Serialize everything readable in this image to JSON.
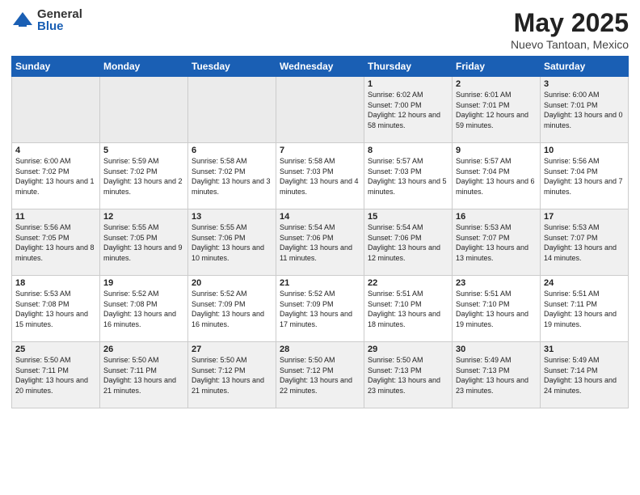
{
  "logo": {
    "general": "General",
    "blue": "Blue"
  },
  "title": "May 2025",
  "subtitle": "Nuevo Tantoan, Mexico",
  "weekdays": [
    "Sunday",
    "Monday",
    "Tuesday",
    "Wednesday",
    "Thursday",
    "Friday",
    "Saturday"
  ],
  "weeks": [
    [
      {
        "day": "",
        "sunrise": "",
        "sunset": "",
        "daylight": ""
      },
      {
        "day": "",
        "sunrise": "",
        "sunset": "",
        "daylight": ""
      },
      {
        "day": "",
        "sunrise": "",
        "sunset": "",
        "daylight": ""
      },
      {
        "day": "",
        "sunrise": "",
        "sunset": "",
        "daylight": ""
      },
      {
        "day": "1",
        "sunrise": "Sunrise: 6:02 AM",
        "sunset": "Sunset: 7:00 PM",
        "daylight": "Daylight: 12 hours and 58 minutes."
      },
      {
        "day": "2",
        "sunrise": "Sunrise: 6:01 AM",
        "sunset": "Sunset: 7:01 PM",
        "daylight": "Daylight: 12 hours and 59 minutes."
      },
      {
        "day": "3",
        "sunrise": "Sunrise: 6:00 AM",
        "sunset": "Sunset: 7:01 PM",
        "daylight": "Daylight: 13 hours and 0 minutes."
      }
    ],
    [
      {
        "day": "4",
        "sunrise": "Sunrise: 6:00 AM",
        "sunset": "Sunset: 7:02 PM",
        "daylight": "Daylight: 13 hours and 1 minute."
      },
      {
        "day": "5",
        "sunrise": "Sunrise: 5:59 AM",
        "sunset": "Sunset: 7:02 PM",
        "daylight": "Daylight: 13 hours and 2 minutes."
      },
      {
        "day": "6",
        "sunrise": "Sunrise: 5:58 AM",
        "sunset": "Sunset: 7:02 PM",
        "daylight": "Daylight: 13 hours and 3 minutes."
      },
      {
        "day": "7",
        "sunrise": "Sunrise: 5:58 AM",
        "sunset": "Sunset: 7:03 PM",
        "daylight": "Daylight: 13 hours and 4 minutes."
      },
      {
        "day": "8",
        "sunrise": "Sunrise: 5:57 AM",
        "sunset": "Sunset: 7:03 PM",
        "daylight": "Daylight: 13 hours and 5 minutes."
      },
      {
        "day": "9",
        "sunrise": "Sunrise: 5:57 AM",
        "sunset": "Sunset: 7:04 PM",
        "daylight": "Daylight: 13 hours and 6 minutes."
      },
      {
        "day": "10",
        "sunrise": "Sunrise: 5:56 AM",
        "sunset": "Sunset: 7:04 PM",
        "daylight": "Daylight: 13 hours and 7 minutes."
      }
    ],
    [
      {
        "day": "11",
        "sunrise": "Sunrise: 5:56 AM",
        "sunset": "Sunset: 7:05 PM",
        "daylight": "Daylight: 13 hours and 8 minutes."
      },
      {
        "day": "12",
        "sunrise": "Sunrise: 5:55 AM",
        "sunset": "Sunset: 7:05 PM",
        "daylight": "Daylight: 13 hours and 9 minutes."
      },
      {
        "day": "13",
        "sunrise": "Sunrise: 5:55 AM",
        "sunset": "Sunset: 7:06 PM",
        "daylight": "Daylight: 13 hours and 10 minutes."
      },
      {
        "day": "14",
        "sunrise": "Sunrise: 5:54 AM",
        "sunset": "Sunset: 7:06 PM",
        "daylight": "Daylight: 13 hours and 11 minutes."
      },
      {
        "day": "15",
        "sunrise": "Sunrise: 5:54 AM",
        "sunset": "Sunset: 7:06 PM",
        "daylight": "Daylight: 13 hours and 12 minutes."
      },
      {
        "day": "16",
        "sunrise": "Sunrise: 5:53 AM",
        "sunset": "Sunset: 7:07 PM",
        "daylight": "Daylight: 13 hours and 13 minutes."
      },
      {
        "day": "17",
        "sunrise": "Sunrise: 5:53 AM",
        "sunset": "Sunset: 7:07 PM",
        "daylight": "Daylight: 13 hours and 14 minutes."
      }
    ],
    [
      {
        "day": "18",
        "sunrise": "Sunrise: 5:53 AM",
        "sunset": "Sunset: 7:08 PM",
        "daylight": "Daylight: 13 hours and 15 minutes."
      },
      {
        "day": "19",
        "sunrise": "Sunrise: 5:52 AM",
        "sunset": "Sunset: 7:08 PM",
        "daylight": "Daylight: 13 hours and 16 minutes."
      },
      {
        "day": "20",
        "sunrise": "Sunrise: 5:52 AM",
        "sunset": "Sunset: 7:09 PM",
        "daylight": "Daylight: 13 hours and 16 minutes."
      },
      {
        "day": "21",
        "sunrise": "Sunrise: 5:52 AM",
        "sunset": "Sunset: 7:09 PM",
        "daylight": "Daylight: 13 hours and 17 minutes."
      },
      {
        "day": "22",
        "sunrise": "Sunrise: 5:51 AM",
        "sunset": "Sunset: 7:10 PM",
        "daylight": "Daylight: 13 hours and 18 minutes."
      },
      {
        "day": "23",
        "sunrise": "Sunrise: 5:51 AM",
        "sunset": "Sunset: 7:10 PM",
        "daylight": "Daylight: 13 hours and 19 minutes."
      },
      {
        "day": "24",
        "sunrise": "Sunrise: 5:51 AM",
        "sunset": "Sunset: 7:11 PM",
        "daylight": "Daylight: 13 hours and 19 minutes."
      }
    ],
    [
      {
        "day": "25",
        "sunrise": "Sunrise: 5:50 AM",
        "sunset": "Sunset: 7:11 PM",
        "daylight": "Daylight: 13 hours and 20 minutes."
      },
      {
        "day": "26",
        "sunrise": "Sunrise: 5:50 AM",
        "sunset": "Sunset: 7:11 PM",
        "daylight": "Daylight: 13 hours and 21 minutes."
      },
      {
        "day": "27",
        "sunrise": "Sunrise: 5:50 AM",
        "sunset": "Sunset: 7:12 PM",
        "daylight": "Daylight: 13 hours and 21 minutes."
      },
      {
        "day": "28",
        "sunrise": "Sunrise: 5:50 AM",
        "sunset": "Sunset: 7:12 PM",
        "daylight": "Daylight: 13 hours and 22 minutes."
      },
      {
        "day": "29",
        "sunrise": "Sunrise: 5:50 AM",
        "sunset": "Sunset: 7:13 PM",
        "daylight": "Daylight: 13 hours and 23 minutes."
      },
      {
        "day": "30",
        "sunrise": "Sunrise: 5:49 AM",
        "sunset": "Sunset: 7:13 PM",
        "daylight": "Daylight: 13 hours and 23 minutes."
      },
      {
        "day": "31",
        "sunrise": "Sunrise: 5:49 AM",
        "sunset": "Sunset: 7:14 PM",
        "daylight": "Daylight: 13 hours and 24 minutes."
      }
    ]
  ]
}
